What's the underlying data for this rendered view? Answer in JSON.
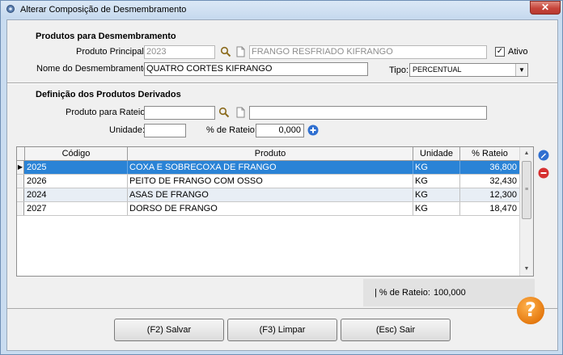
{
  "window": {
    "title": "Alterar Composição de Desmembramento",
    "close_glyph": "✕"
  },
  "section1": {
    "title": "Produtos para Desmembramento",
    "produto_principal_label": "Produto Principal:",
    "produto_principal_code": "2023",
    "produto_principal_desc": "FRANGO RESFRIADO KIFRANGO",
    "ativo_label": "Ativo",
    "ativo_checked": true,
    "nome_label": "Nome do Desmembramento:",
    "nome_value": "QUATRO CORTES KIFRANGO",
    "tipo_label": "Tipo:",
    "tipo_value": "PERCENTUAL"
  },
  "section2": {
    "title": "Definição dos Produtos Derivados",
    "produto_rateio_label": "Produto para Rateio:",
    "produto_rateio_code": "",
    "produto_rateio_desc": "",
    "unidade_label": "Unidade:",
    "unidade_value": "",
    "perc_rateio_label": "% de Rateio:",
    "perc_rateio_value": "0,000"
  },
  "grid": {
    "columns": [
      "Código",
      "Produto",
      "Unidade",
      "% Rateio"
    ],
    "rows": [
      {
        "codigo": "2025",
        "produto": "COXA E SOBRECOXA DE FRANGO",
        "unidade": "KG",
        "rateio": "36,800"
      },
      {
        "codigo": "2026",
        "produto": "PEITO DE FRANGO COM OSSO",
        "unidade": "KG",
        "rateio": "32,430"
      },
      {
        "codigo": "2024",
        "produto": "ASAS DE FRANGO",
        "unidade": "KG",
        "rateio": "12,300"
      },
      {
        "codigo": "2027",
        "produto": "DORSO DE FRANGO",
        "unidade": "KG",
        "rateio": "18,470"
      }
    ],
    "selected_row": 0
  },
  "summary": {
    "label": "| % de Rateio:",
    "value": "100,000"
  },
  "buttons": {
    "salvar": "(F2) Salvar",
    "limpar": "(F3) Limpar",
    "sair": "(Esc) Sair"
  },
  "help_glyph": "?",
  "colors": {
    "selection": "#2a83d6",
    "help": "#e57a10",
    "close": "#c6453b",
    "edit_icon": "#2f6fd0",
    "remove_icon": "#d63030"
  }
}
